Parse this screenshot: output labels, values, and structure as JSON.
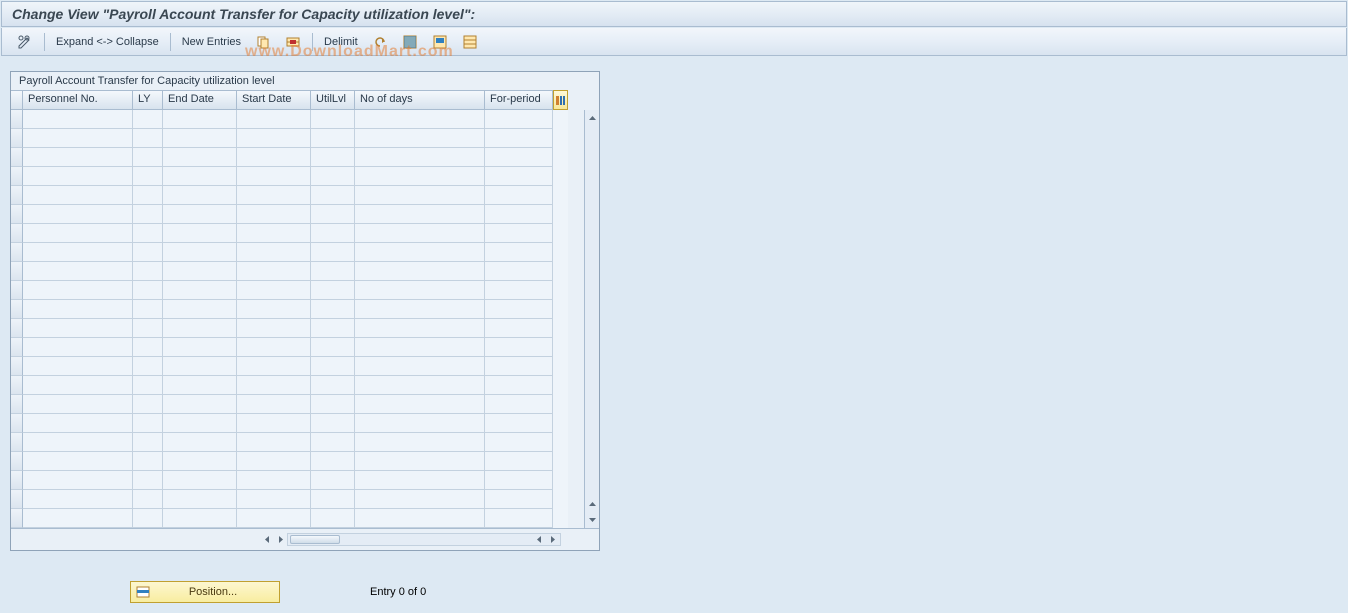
{
  "title": "Change View \"Payroll Account Transfer for Capacity utilization level\":",
  "toolbar": {
    "expand_collapse": "Expand <-> Collapse",
    "new_entries": "New Entries",
    "delimit": "Delimit"
  },
  "watermark": "www.DownloadMart.com",
  "grid": {
    "title": "Payroll Account Transfer for Capacity utilization level",
    "columns": [
      {
        "label": "Personnel No.",
        "width": 110
      },
      {
        "label": "LY",
        "width": 30
      },
      {
        "label": "End Date",
        "width": 74
      },
      {
        "label": "Start Date",
        "width": 74
      },
      {
        "label": "UtilLvl",
        "width": 44
      },
      {
        "label": "No of days",
        "width": 130
      },
      {
        "label": "For-period",
        "width": 68
      }
    ],
    "row_count": 22
  },
  "footer": {
    "position_label": "Position...",
    "entry_text": "Entry 0 of 0"
  }
}
